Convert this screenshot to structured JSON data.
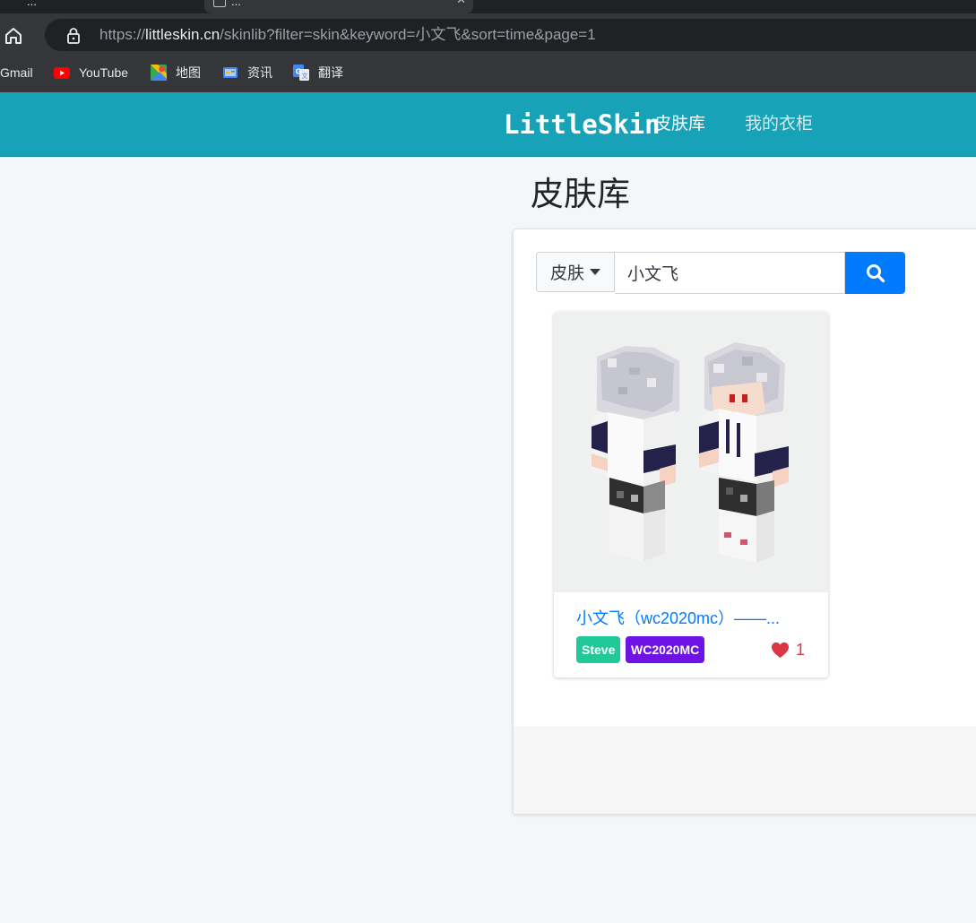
{
  "browser": {
    "tabs": [
      {
        "title": "...",
        "active": false
      },
      {
        "title": "...",
        "active": true
      },
      {
        "title": "",
        "active": false
      }
    ],
    "address": {
      "scheme": "https://",
      "host": "littleskin.cn",
      "path": "/skinlib?filter=skin&keyword=小文飞&sort=time&page=1"
    },
    "bookmarks": [
      {
        "label": "Gmail",
        "icon": "gmail-icon"
      },
      {
        "label": "YouTube",
        "icon": "youtube-icon"
      },
      {
        "label": "地图",
        "icon": "maps-icon"
      },
      {
        "label": "资讯",
        "icon": "news-icon"
      },
      {
        "label": "翻译",
        "icon": "translate-icon"
      }
    ]
  },
  "site": {
    "brand": "LittleSkin",
    "nav": [
      {
        "label": "皮肤库",
        "active": true
      },
      {
        "label": "我的衣柜",
        "active": false
      }
    ],
    "colors": {
      "navbar": "#17a2b8",
      "primary": "#007bff",
      "model_badge": "#20c997",
      "uploader_badge": "#6f12e5",
      "like": "#dc3545"
    }
  },
  "page": {
    "title": "皮肤库",
    "search": {
      "filter_label": "皮肤",
      "keyword": "小文飞",
      "button_icon": "search-icon"
    },
    "results": [
      {
        "name": "小文飞（wc2020mc）——...",
        "model": "Steve",
        "uploader": "WC2020MC",
        "likes": "1"
      }
    ]
  }
}
